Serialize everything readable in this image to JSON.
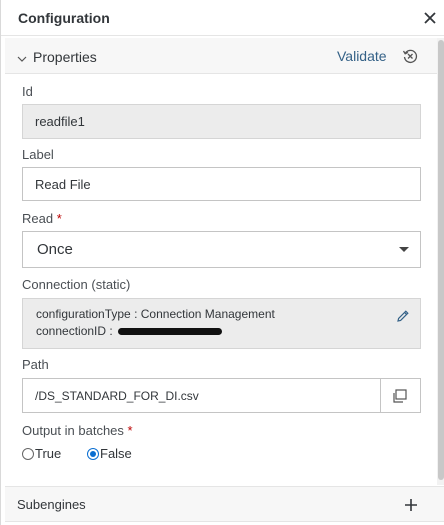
{
  "dialog": {
    "title": "Configuration",
    "close_icon": "close-icon"
  },
  "section": {
    "title": "Properties",
    "validate_label": "Validate",
    "chevron_icon": "chevron-down-icon",
    "reset_icon": "reset-icon"
  },
  "fields": {
    "id": {
      "label": "Id",
      "value": "readfile1"
    },
    "label": {
      "label": "Label",
      "value": "Read File"
    },
    "read": {
      "label": "Read",
      "required_mark": "*",
      "value": "Once"
    },
    "connection": {
      "label": "Connection (static)",
      "configuration_type_key": "configurationType",
      "configuration_type_value": "Connection Management",
      "connection_id_key": "connectionID",
      "separator": " : ",
      "edit_icon": "pencil-icon"
    },
    "path": {
      "label": "Path",
      "value": "/DS_STANDARD_FOR_DI.csv",
      "browse_icon": "copy-icon"
    },
    "output_in_batches": {
      "label": "Output in batches",
      "required_mark": "*",
      "options": [
        {
          "label": "True",
          "selected": false
        },
        {
          "label": "False",
          "selected": true
        }
      ]
    }
  },
  "footer": {
    "title": "Subengines",
    "add_icon": "plus-icon"
  },
  "colors": {
    "accent": "#0a6ed1",
    "link": "#346187",
    "required": "#bb0000",
    "readonly_bg": "#ececec"
  }
}
